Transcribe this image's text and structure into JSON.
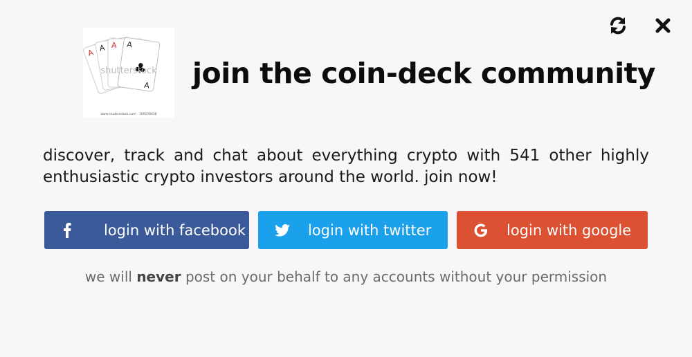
{
  "header": {
    "title": "join the coin-deck community",
    "logo_watermark": "shutterstock",
    "logo_caption": "www.shutterstock.com · 100156438"
  },
  "description": "discover, track and chat about everything crypto with 541 other highly enthusiastic crypto investors around the world. join now!",
  "buttons": {
    "facebook": {
      "label": "login with facebook",
      "icon": "facebook-icon",
      "color": "#3b5a9a"
    },
    "twitter": {
      "label": "login with twitter",
      "icon": "twitter-icon",
      "color": "#1ba1ec"
    },
    "google": {
      "label": "login with google",
      "icon": "google-icon",
      "color": "#dd5133"
    }
  },
  "note": {
    "before": "we will",
    "emphasis": "never",
    "after": "post on your behalf to any accounts without your permission"
  },
  "toolbar": {
    "refresh_icon": "refresh-icon",
    "close_icon": "close-icon"
  }
}
